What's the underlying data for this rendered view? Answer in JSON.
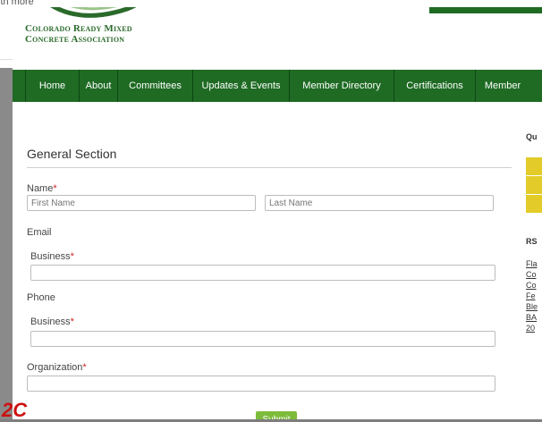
{
  "background": {
    "snippet": "ith more"
  },
  "logo": {
    "line1": "Colorado Ready Mixed",
    "line2": "Concrete Association"
  },
  "nav": {
    "items": [
      {
        "label": "Home"
      },
      {
        "label": "About"
      },
      {
        "label": "Committees"
      },
      {
        "label": "Updates & Events"
      },
      {
        "label": "Member Directory"
      },
      {
        "label": "Certifications"
      },
      {
        "label": "Member"
      }
    ]
  },
  "form": {
    "section_title": "General Section",
    "name_label": "Name",
    "first_name_placeholder": "First Name",
    "last_name_placeholder": "Last Name",
    "email_label": "Email",
    "email_business_label": "Business",
    "phone_label": "Phone",
    "phone_business_label": "Business",
    "organization_label": "Organization",
    "required_mark": "*",
    "submit_label": "Submit"
  },
  "sidebar": {
    "heading1": "Qu",
    "heading2": "RS",
    "links": [
      "Fla",
      "Co",
      "Co",
      "Fe",
      "Ble",
      "BA",
      "20"
    ]
  },
  "overlay": {
    "badge": "2C"
  },
  "colors": {
    "nav_green": "#1f6b24",
    "submit_green": "#7dbb3a",
    "required_red": "#cc2222",
    "badge_red": "#cc1111",
    "sidebar_yellow": "#e3cc2a"
  }
}
